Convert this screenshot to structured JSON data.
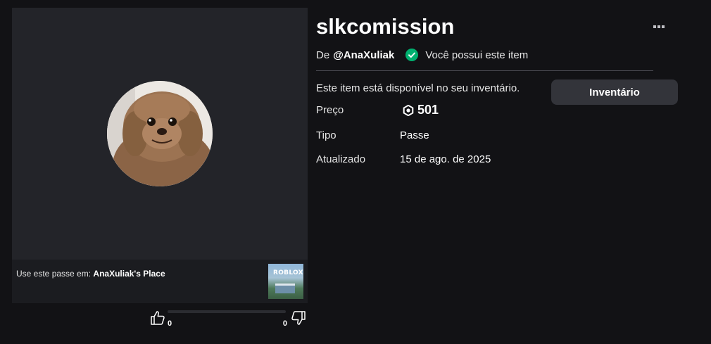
{
  "item": {
    "title": "slkcomission",
    "by_prefix": "De",
    "creator": "@AnaXuliak",
    "owned_text": "Você possui este item",
    "availability_text": "Este item está disponível no seu inventário.",
    "inventory_button_label": "Inventário"
  },
  "details": {
    "price_label": "Preço",
    "price_value": "501",
    "type_label": "Tipo",
    "type_value": "Passe",
    "updated_label": "Atualizado",
    "updated_value": "15 de ago. de 2025"
  },
  "place": {
    "prefix": "Use este passe em:",
    "name": "AnaXuliak's Place",
    "thumbnail_logo_text": "ROBLOX"
  },
  "votes": {
    "up_count": "0",
    "down_count": "0"
  },
  "icons": {
    "more": "ellipsis-icon",
    "owned": "check-circle-icon",
    "currency": "robux-icon",
    "upvote": "thumbs-up-icon",
    "downvote": "thumbs-down-icon"
  },
  "colors": {
    "background": "#121215",
    "panel": "#232429",
    "owned_check": "#00b06f",
    "button": "#33343a"
  }
}
